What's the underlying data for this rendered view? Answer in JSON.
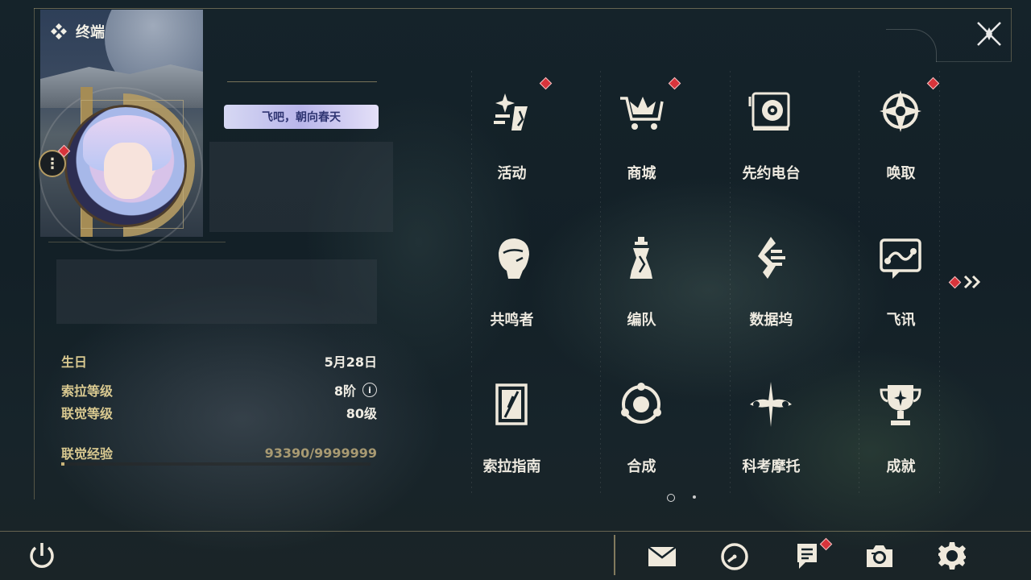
{
  "terminal": {
    "title": "终端"
  },
  "profile": {
    "signature_badge": "飞吧，朝向春天"
  },
  "stats": {
    "birthday_label": "生日",
    "birthday_value": "5月28日",
    "sola_level_label": "索拉等级",
    "sola_level_value": "8阶",
    "union_level_label": "联觉等级",
    "union_level_value": "80级",
    "union_exp_label": "联觉经验",
    "union_exp_value": "93390/9999999",
    "union_exp_progress": 0.0093
  },
  "menu": [
    {
      "label": "活动",
      "icon": "activity-icon",
      "notify": true
    },
    {
      "label": "商城",
      "icon": "shop-cart-icon",
      "notify": true
    },
    {
      "label": "先约电台",
      "icon": "radio-icon",
      "notify": false
    },
    {
      "label": "唤取",
      "icon": "summon-icon",
      "notify": true
    },
    {
      "label": "共鸣者",
      "icon": "resonator-icon",
      "notify": false
    },
    {
      "label": "编队",
      "icon": "chess-team-icon",
      "notify": false
    },
    {
      "label": "数据坞",
      "icon": "data-bank-icon",
      "notify": false
    },
    {
      "label": "飞讯",
      "icon": "message-icon",
      "notify": false
    },
    {
      "label": "索拉指南",
      "icon": "guide-book-icon",
      "notify": false
    },
    {
      "label": "合成",
      "icon": "synthesis-icon",
      "notify": false
    },
    {
      "label": "科考摩托",
      "icon": "motorcycle-icon",
      "notify": false
    },
    {
      "label": "成就",
      "icon": "trophy-icon",
      "notify": false
    }
  ],
  "pagination": {
    "current": 1,
    "total": 2
  },
  "colors": {
    "accent_gold": "#b49b63",
    "notify_red": "#d8343b",
    "label_gold": "#d9c990"
  },
  "bottom_bar": [
    "power-icon",
    "mail-icon",
    "clock-icon",
    "notice-icon",
    "camera-icon",
    "settings-gear-icon"
  ]
}
